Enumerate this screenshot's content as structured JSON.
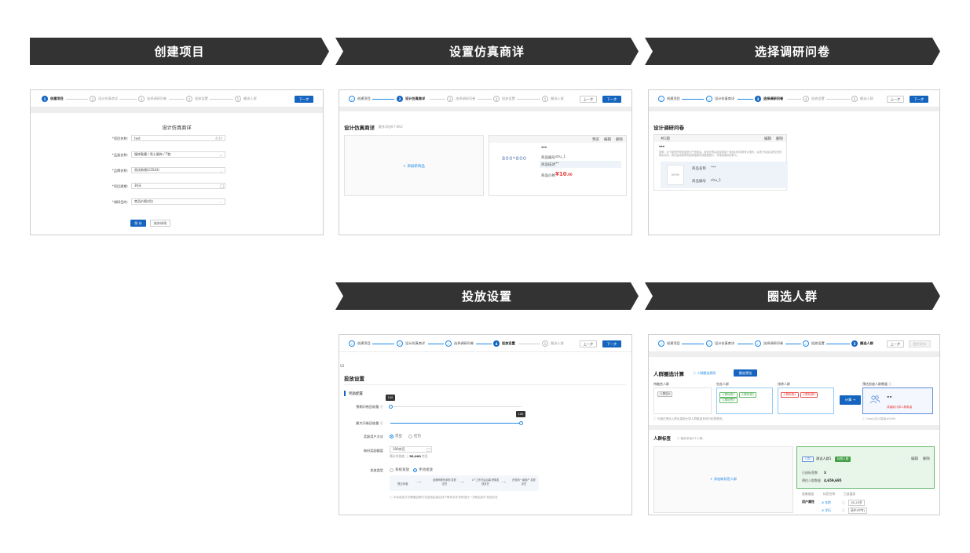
{
  "headers": [
    "创建项目",
    "设置仿真商详",
    "选择调研问卷",
    "投放设置",
    "圈选人群"
  ],
  "steps": [
    "创建项目",
    "设计仿真商详",
    "选择调研问卷",
    "投放设置",
    "圈选人群"
  ],
  "buttons": {
    "next": "下一步",
    "prev": "上一步",
    "save": "保 存",
    "discard": "放弃修改",
    "submit": "提交发布",
    "compute": "计算 →"
  },
  "s1": {
    "title": "设计仿真商详",
    "fields": [
      {
        "label": "*项目名称:",
        "value": "test",
        "extra": "4/30"
      },
      {
        "label": "*品类名称:",
        "value": "服饰鞋履 / 男士服饰 / T恤"
      },
      {
        "label": "*品牌名称:",
        "value": "测试新增(23543)"
      },
      {
        "label": "*项目周期:",
        "value": "30天"
      },
      {
        "label": "*调研目的:",
        "value": "商品价格对比"
      }
    ]
  },
  "s2": {
    "title": "设计仿真商详",
    "hint": "最多添加6个SKU",
    "add_product": "+ 添加新商品",
    "actions": [
      "预览",
      "编辑",
      "删除"
    ],
    "image_placeholder": "800*800",
    "product_name": "***",
    "code_label": "商品编号",
    "code_value": "shu_1",
    "desc_label": "商品描述",
    "desc_value": "**",
    "price_label": "商品价格",
    "price_value": "¥10",
    "price_unit": ".00"
  },
  "s3": {
    "title": "设计调研问卷",
    "q_index": "共1题",
    "actions": [
      "编辑",
      "删除"
    ],
    "q_name": "***",
    "q_desc": "说明：对下面的所有商品进行产品购买，若你在购买前发现某个商品对你非常有价值时，请进行勾选并提交你的购买意向，我们会收集你的选择结果完成数据统计，非常感谢你的参与。",
    "img_placeholder": "80*80",
    "name_label": "商品名称",
    "name_value": "***",
    "code_label": "商品编号",
    "code_value": "shu_1"
  },
  "s4": {
    "ver": "V2",
    "title": "投放设置",
    "section": "奖励配置",
    "rows": [
      "预期问卷回收量 ⓘ",
      "最大问卷回收量 ⓘ",
      "奖励用户方式",
      "每份奖励额度",
      "发放类型"
    ],
    "tip1": "100",
    "tip2": "100",
    "radio_a": "京豆",
    "radio_b": "红包",
    "amount": "100京豆",
    "estimate_label": "预计共发放 ⓘ",
    "estimate_value": "50,000",
    "estimate_unit": "京豆",
    "type_a": "系统发放",
    "type_b": "手动发放",
    "flow": [
      "提交问卷",
      "品牌商联系采购 发放京豆",
      "1个工作日后后端 获取发放京豆",
      "在电商一键用户 发放京豆"
    ],
    "flow_note": "ⓘ 手动发放方式需要品牌方在投放结束后线下联系京东采购进行一对账后用户发放京豆"
  },
  "s5": {
    "calc_title": "人群圈选计算",
    "calc_link": "ⓘ 人群圈选规则",
    "calc_btn": "圈选预览",
    "col_a": "待融合人群",
    "col_b": "包含人群",
    "col_c": "排除人群",
    "col_d": "预估投放人群数量 ⓘ",
    "tag_a": "人群包A",
    "tags_b": [
      "人群标签1",
      "人群标签2",
      "人群标签3"
    ],
    "tags_c": [
      "人群标签4",
      "人群标签5"
    ],
    "dash": "--",
    "result_note": "请重新计算人群数量",
    "foot_left": "ⓘ 可通过筛选人群包重新计算人群数量来进行权限筛选。",
    "foot_right": "ⓘ 10w以内人群量≤5000",
    "tags_title": "人群标签",
    "tags_hint": "ⓘ 最多添加6个人群。",
    "add_tag": "+ 添加新标签人群",
    "panel_chip": "人群1",
    "panel_name": "测试人群1",
    "panel_badge": "标签人群",
    "panel_actions": [
      "编辑",
      "删除"
    ],
    "selected_label": "已选标签数",
    "selected_value": "3",
    "est_label": "预估人群数量",
    "est_value": "4,659,695",
    "sub_tabs": [
      "画像维度",
      "标签名称",
      "已选值类"
    ],
    "attr_label": "用户属性",
    "attr_rows": [
      {
        "k": "# 年龄",
        "v": "18-25岁"
      },
      {
        "k": "# 学历",
        "v": "高中(中专)"
      }
    ]
  }
}
